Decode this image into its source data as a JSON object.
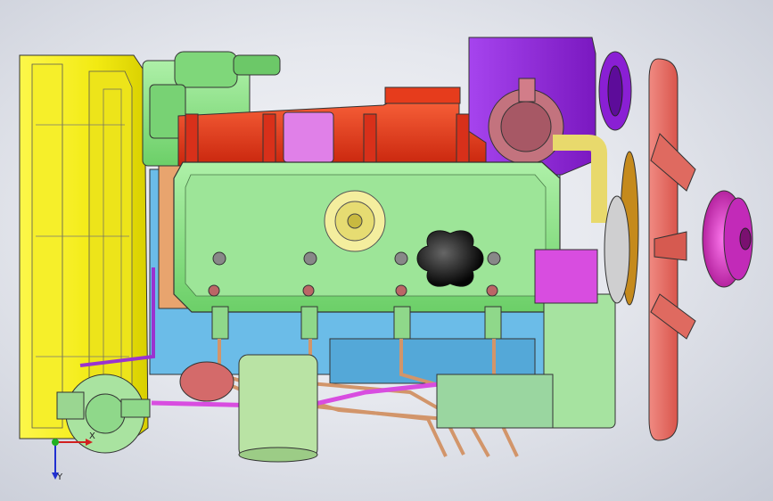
{
  "viewport": {
    "background": "#e6e8ee",
    "colors": {
      "flywheel_housing": "#f5f015",
      "intake_manifold": "#e23a1c",
      "valve_cover": "#8fe08a",
      "timing_cover": "#9b2bd9",
      "fan": "#e87168",
      "pulley": "#d63fcc",
      "fuel_lines": "#d2956a",
      "thermostat_housing": "#c8706d",
      "water_pipe": "#e3d36b",
      "oil_filter": "#b7e0a0",
      "block_blue": "#5fb5e6",
      "magenta_parts": "#d84de0"
    }
  },
  "triad": {
    "x_label": "X",
    "y_label": "Y",
    "x_color": "#d12020",
    "y_color": "#2030d0",
    "origin_color": "#20b020"
  }
}
